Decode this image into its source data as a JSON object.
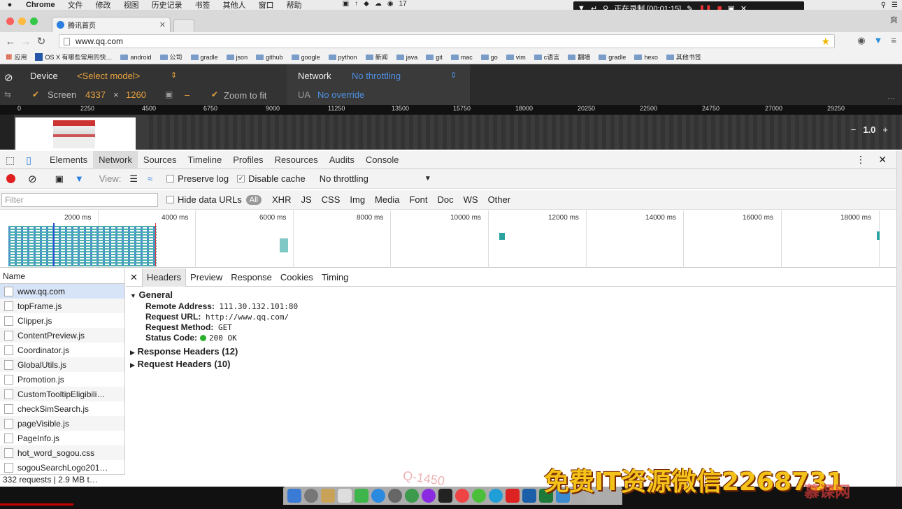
{
  "menubar": {
    "app": "Chrome",
    "items": [
      "文件",
      "修改",
      "视图",
      "历史记录",
      "书签",
      "其他人",
      "窗口",
      "帮助"
    ],
    "battery": "17"
  },
  "recorder": {
    "label": "正在录制 [00:01:15]"
  },
  "browser": {
    "tab_title": "腾讯首页",
    "url": "www.qq.com",
    "profile": "爽"
  },
  "bookmarks": [
    "应用",
    "OS X 有哪些常用的快…",
    "android",
    "公司",
    "gradle",
    "json",
    "github",
    "google",
    "python",
    "新闻",
    "java",
    "git",
    "mac",
    "go",
    "vim",
    "c语言",
    "翻墙",
    "gradle",
    "hexo",
    "其他书签"
  ],
  "device": {
    "device_label": "Device",
    "model": "<Select model>",
    "screen_label": "Screen",
    "width": "4337",
    "times": "×",
    "height": "1260",
    "dash": "–",
    "zoom_label": "Zoom to fit",
    "network_label": "Network",
    "throttle": "No throttling",
    "ua_label": "UA",
    "ua_value": "No override",
    "ruler": [
      "0",
      "2250",
      "4500",
      "6750",
      "9000",
      "11250",
      "13500",
      "15750",
      "18000",
      "20250",
      "22500",
      "24750",
      "27000",
      "29250"
    ],
    "zoom_value": "1.0"
  },
  "devtools": {
    "tabs": [
      "Elements",
      "Network",
      "Sources",
      "Timeline",
      "Profiles",
      "Resources",
      "Audits",
      "Console"
    ],
    "view_label": "View:",
    "preserve_log": "Preserve log",
    "disable_cache": "Disable cache",
    "throttling": "No throttling",
    "filter_placeholder": "Filter",
    "hide_data_urls": "Hide data URLs",
    "types": [
      "All",
      "XHR",
      "JS",
      "CSS",
      "Img",
      "Media",
      "Font",
      "Doc",
      "WS",
      "Other"
    ],
    "timeline_ticks": [
      "2000 ms",
      "4000 ms",
      "6000 ms",
      "8000 ms",
      "10000 ms",
      "12000 ms",
      "14000 ms",
      "16000 ms",
      "18000 ms"
    ]
  },
  "requests": {
    "header": "Name",
    "items": [
      "www.qq.com",
      "topFrame.js",
      "Clipper.js",
      "ContentPreview.js",
      "Coordinator.js",
      "GlobalUtils.js",
      "Promotion.js",
      "CustomTooltipEligibili…",
      "checkSimSearch.js",
      "pageVisible.js",
      "PageInfo.js",
      "hot_word_sogou.css",
      "sogouSearchLogo201…"
    ],
    "status": "332 requests | 2.9 MB t…"
  },
  "detail": {
    "tabs": [
      "Headers",
      "Preview",
      "Response",
      "Cookies",
      "Timing"
    ],
    "general": "General",
    "remote_address_label": "Remote Address:",
    "remote_address": "111.30.132.101:80",
    "request_url_label": "Request URL:",
    "request_url": "http://www.qq.com/",
    "method_label": "Request Method:",
    "method": "GET",
    "status_label": "Status Code:",
    "status": "200 OK",
    "response_headers": "Response Headers (12)",
    "request_headers": "Request Headers (10)"
  },
  "overlay": {
    "watermark": "免费IT资源微信2268731",
    "q_mark": "Q-1450",
    "brand": "慕课网"
  },
  "colors": {
    "record_red": "#e02020",
    "accent_blue": "#4e8fe0",
    "device_orange": "#e8a33d",
    "status_green": "#2ab02a"
  }
}
